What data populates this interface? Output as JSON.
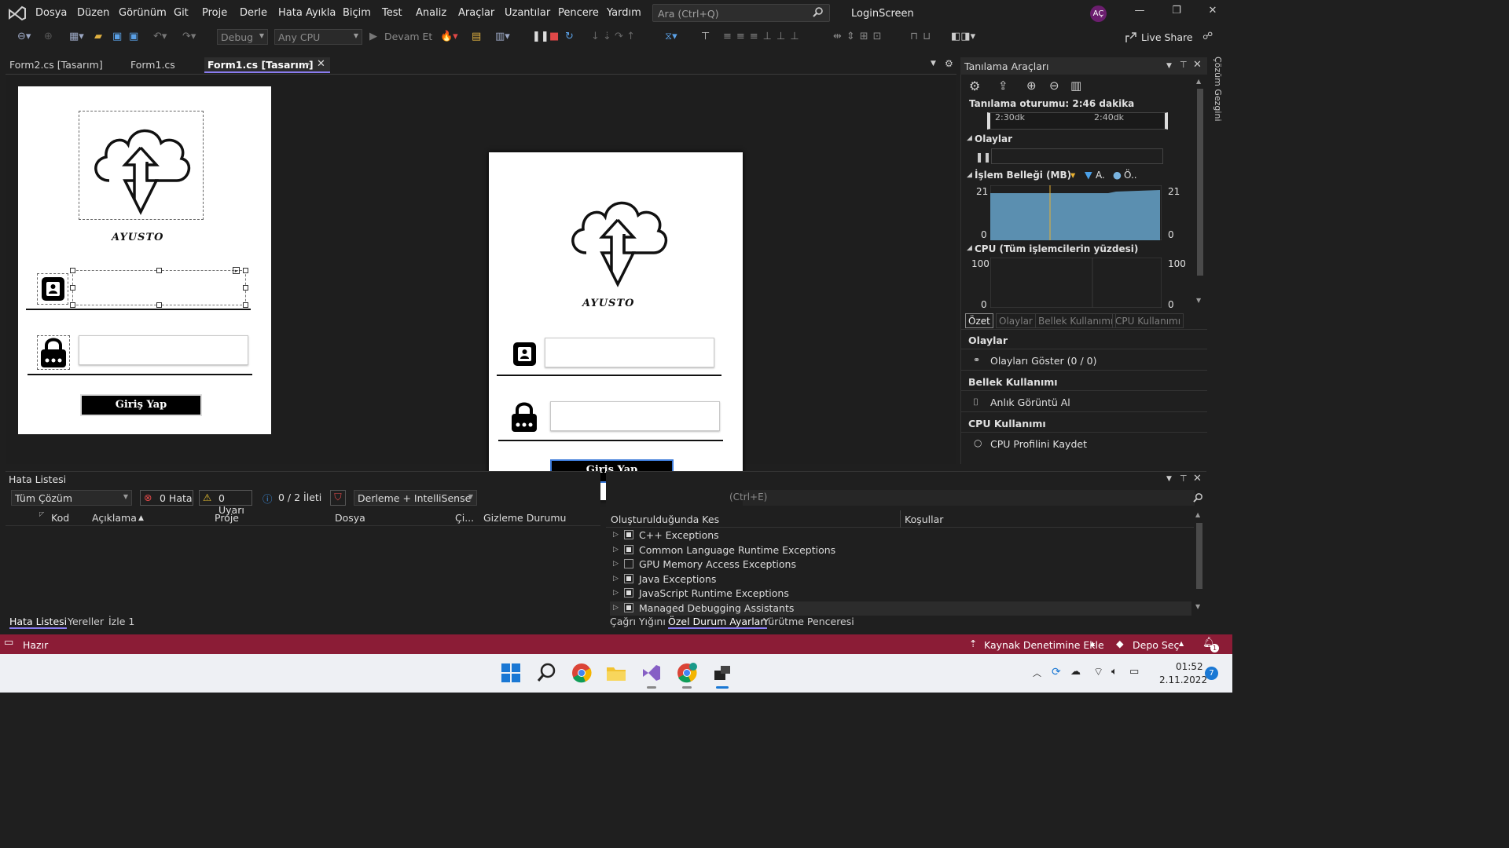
{
  "menubar": {
    "items": [
      "Dosya",
      "Düzen",
      "Görünüm",
      "Git",
      "Proje",
      "Derle",
      "Hata Ayıkla",
      "Biçim",
      "Test",
      "Analiz",
      "Araçlar",
      "Uzantılar",
      "Pencere",
      "Yardım"
    ],
    "search_placeholder": "Ara (Ctrl+Q)",
    "solution_title": "LoginScreen",
    "avatar": "AÇ"
  },
  "toolbar": {
    "config": "Debug",
    "platform": "Any CPU",
    "continue": "Devam Et",
    "live_share": "Live Share"
  },
  "doc_tabs": [
    {
      "label": "Form2.cs [Tasarım]"
    },
    {
      "label": "Form1.cs"
    },
    {
      "label": "Form1.cs [Tasarım]",
      "active": true
    }
  ],
  "form": {
    "brand": "AYUSTO",
    "login_button": "Giriş Yap"
  },
  "diagnostics": {
    "title": "Tanılama Araçları",
    "session": "Tanılama oturumu: 2:46 dakika",
    "timeline": [
      "2:30dk",
      "2:40dk"
    ],
    "events_label": "Olaylar",
    "memory_label": "İşlem Belleği (MB)",
    "memory_legend": [
      "A.",
      "Ö.."
    ],
    "memory_max": "21",
    "memory_min": "0",
    "cpu_label": "CPU (Tüm işlemcilerin yüzdesi)",
    "cpu_max": "100",
    "cpu_min": "0",
    "subtabs": [
      "Özet",
      "Olaylar",
      "Bellek Kullanımı",
      "CPU Kullanımı"
    ],
    "events_header": "Olaylar",
    "show_events": "Olayları Göster (0 / 0)",
    "memory_header": "Bellek Kullanımı",
    "snapshot": "Anlık Görüntü Al",
    "cpu_header": "CPU Kullanımı",
    "cpu_profile": "CPU Profilini Kaydet"
  },
  "error_list": {
    "title": "Hata Listesi",
    "scope": "Tüm Çözüm",
    "errors": "0 Hata",
    "warnings": "0 Uyarı",
    "messages": "0 / 2 İleti",
    "build_filter": "Derleme + IntelliSense",
    "columns": [
      "Kod",
      "Açıklama",
      "Proje",
      "Dosya",
      "Çi...",
      "Gizleme Durumu"
    ],
    "tabs": [
      "Hata Listesi",
      "Yereller",
      "İzle 1"
    ]
  },
  "exceptions": {
    "search_hint": "(Ctrl+E)",
    "col_break": "Oluşturulduğunda Kes",
    "col_conditions": "Koşullar",
    "rows": [
      {
        "label": "C++ Exceptions",
        "checked": true
      },
      {
        "label": "Common Language Runtime Exceptions",
        "checked": true
      },
      {
        "label": "GPU Memory Access Exceptions",
        "checked": false
      },
      {
        "label": "Java Exceptions",
        "checked": true
      },
      {
        "label": "JavaScript Runtime Exceptions",
        "checked": true
      },
      {
        "label": "Managed Debugging Assistants",
        "checked": true
      }
    ],
    "tabs": [
      "Çağrı Yığını",
      "Özel Durum Ayarları",
      "Yürütme Penceresi"
    ]
  },
  "statusbar": {
    "ready": "Hazır",
    "source_control": "Kaynak Denetimine Ekle",
    "repo": "Depo Seç",
    "notif_count": "1"
  },
  "right_rail": {
    "label": "Çözüm Gezgini"
  },
  "taskbar": {
    "time": "01:52",
    "date": "2.11.2022",
    "badge": "7"
  },
  "colors": {
    "accent": "#8a7cf0",
    "status": "#8b1c36",
    "chart": "#5b8fb0"
  }
}
